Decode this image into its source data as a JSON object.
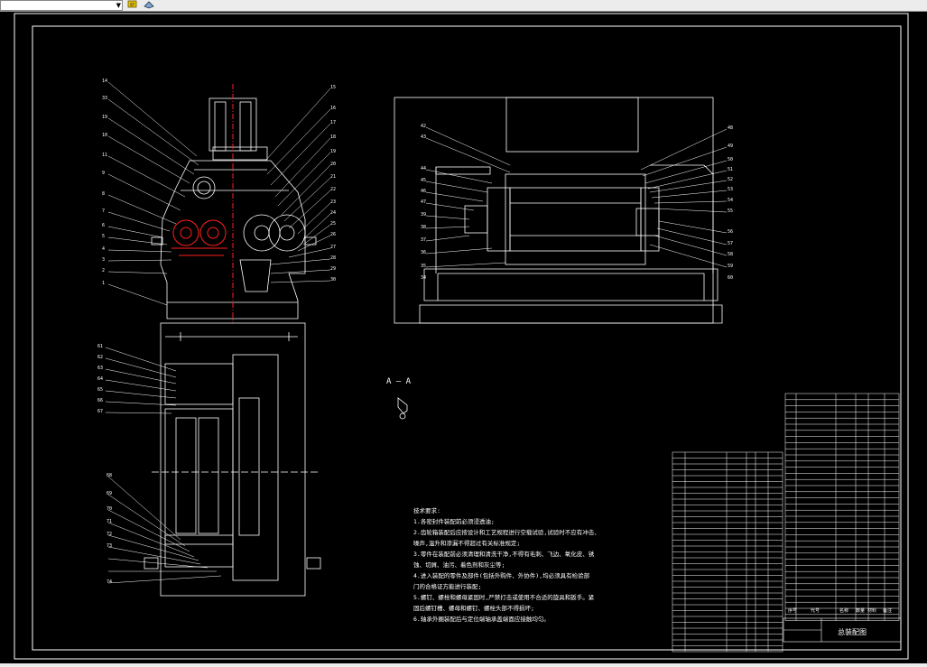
{
  "drawing": {
    "section_label": "A — A",
    "title_block": {
      "name": "总装配图"
    },
    "notes": [
      "技术要求:",
      "1.各密封件装配前必须浸透油;",
      "2.齿轮箱装配后应按设计和工艺规程进行空载试验,试验时不应有冲击、",
      "  噪声,温升和渗漏不得超过有关标准规定;",
      "3.零件在装配前必须清理和清洗干净,不得有毛刺、飞边、氧化皮、锈",
      "  蚀、切屑、油污、着色剂和灰尘等;",
      "4.进入装配的零件及部件(包括外购件、外协件),均必须具有检验部",
      "  门的合格证方能进行装配;",
      "5.螺钉、螺栓和螺母紧固时,严禁打击或使用不合适的旋具和扳手。紧",
      "  固后螺钉槽、螺母和螺钉、螺栓头部不得损坏;",
      "6.轴承外圈装配后与定位端轴承盖端面应接触均匀。"
    ],
    "header_row": [
      "序号",
      "代号",
      "名称",
      "数量",
      "材料",
      "备注"
    ],
    "front_view_labels": [
      "14",
      "33",
      "19",
      "10",
      "11",
      "9",
      "8",
      "7",
      "6",
      "5",
      "4",
      "3",
      "2",
      "1"
    ],
    "front_view_right_labels": [
      "15",
      "16",
      "17",
      "18",
      "19",
      "20",
      "21",
      "22",
      "23",
      "24",
      "25",
      "26",
      "27",
      "28",
      "29",
      "30"
    ],
    "top_view_labels": [
      "61",
      "62",
      "63",
      "64",
      "65",
      "66",
      "67",
      "68",
      "69",
      "70",
      "71",
      "72",
      "73",
      "74"
    ],
    "side_view_left_labels": [
      "42",
      "43",
      "44",
      "45",
      "46",
      "47",
      "39",
      "38",
      "37",
      "36",
      "35",
      "34"
    ],
    "side_view_right_labels": [
      "48",
      "49",
      "50",
      "51",
      "52",
      "53",
      "54",
      "55",
      "56",
      "57",
      "58",
      "59",
      "60"
    ]
  },
  "toolbar": {
    "icons": [
      "combo-box",
      "layer-icon",
      "properties-icon"
    ]
  },
  "colors": {
    "background": "#000000",
    "lines": "#ffffff",
    "red": "#ff2020",
    "grey": "#cfcfcf"
  }
}
